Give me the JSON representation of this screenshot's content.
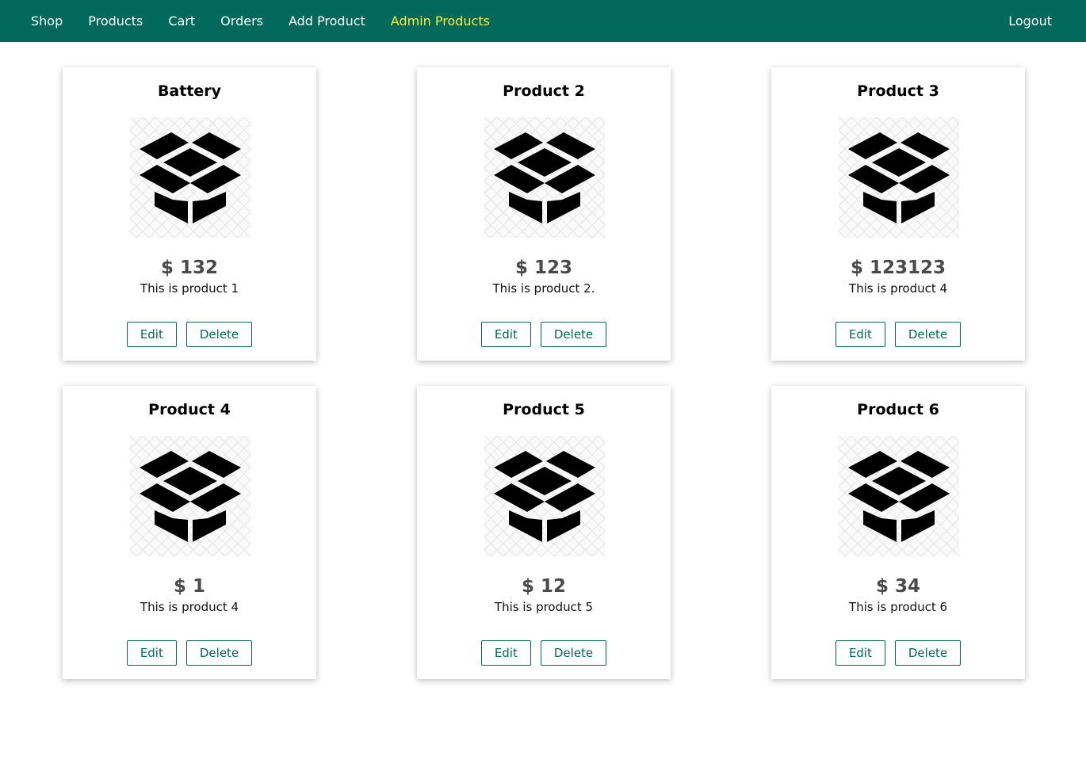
{
  "nav": {
    "left": [
      {
        "label": "Shop"
      },
      {
        "label": "Products"
      },
      {
        "label": "Cart"
      },
      {
        "label": "Orders"
      },
      {
        "label": "Add Product"
      },
      {
        "label": "Admin Products"
      }
    ],
    "active": "Admin Products",
    "logout": "Logout"
  },
  "colors": {
    "header": "#00695c",
    "active_nav": "#ffeb3b",
    "accent": "#00695c"
  },
  "products": [
    {
      "title": "Battery",
      "price": "$ 132",
      "description": "This is product 1",
      "image_icon": "box-icon",
      "edit_label": "Edit",
      "delete_label": "Delete"
    },
    {
      "title": "Product 2",
      "price": "$ 123",
      "description": "This is product 2.",
      "image_icon": "box-icon",
      "edit_label": "Edit",
      "delete_label": "Delete"
    },
    {
      "title": "Product 3",
      "price": "$ 123123",
      "description": "This is product 4",
      "image_icon": "box-icon",
      "edit_label": "Edit",
      "delete_label": "Delete"
    },
    {
      "title": "Product 4",
      "price": "$ 1",
      "description": "This is product 4",
      "image_icon": "box-icon",
      "edit_label": "Edit",
      "delete_label": "Delete"
    },
    {
      "title": "Product 5",
      "price": "$ 12",
      "description": "This is product 5",
      "image_icon": "box-icon",
      "edit_label": "Edit",
      "delete_label": "Delete"
    },
    {
      "title": "Product 6",
      "price": "$ 34",
      "description": "This is product 6",
      "image_icon": "box-icon",
      "edit_label": "Edit",
      "delete_label": "Delete"
    }
  ]
}
